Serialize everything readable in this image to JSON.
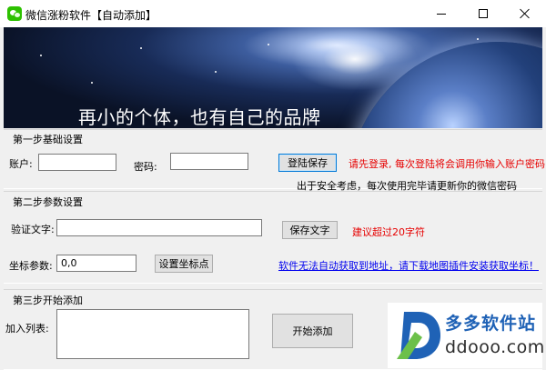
{
  "window": {
    "title": "微信涨粉软件【自动添加】"
  },
  "banner": {
    "slogan": "再小的个体，也有自己的品牌"
  },
  "step1": {
    "title": "第一步基础设置",
    "account_label": "账户:",
    "account_value": "",
    "password_label": "密码:",
    "password_value": "",
    "login_save_label": "登陆保存",
    "hint": "请先登录, 每次登陆将会调用你输入账户密码",
    "security_note": "出于安全考虑，每次使用完毕请更新你的微信密码"
  },
  "step2": {
    "title": "第二步参数设置",
    "verify_label": "验证文字:",
    "verify_value": "",
    "save_text_label": "保存文字",
    "verify_hint": "建议超过20字符",
    "coord_label": "坐标参数:",
    "coord_value": "0,0",
    "set_coord_label": "设置坐标点",
    "coord_link": "软件无法自动获取到地址，请下载地图插件安装获取坐标！"
  },
  "step3": {
    "title": "第三步开始添加",
    "list_label": "加入列表:",
    "list_value": "",
    "start_label": "开始添加"
  },
  "watermark": {
    "name": "多多软件站",
    "url": "ddooo.com"
  },
  "colors": {
    "hint_red": "#e60000",
    "link_blue": "#0000ee",
    "logo_blue": "#1f62b6",
    "focus_border": "#0078d7"
  },
  "icons": {
    "app": "wechat-icon",
    "minimize": "minimize-icon",
    "maximize": "maximize-icon",
    "close": "close-icon",
    "logo": "ddooo-logo-icon"
  }
}
